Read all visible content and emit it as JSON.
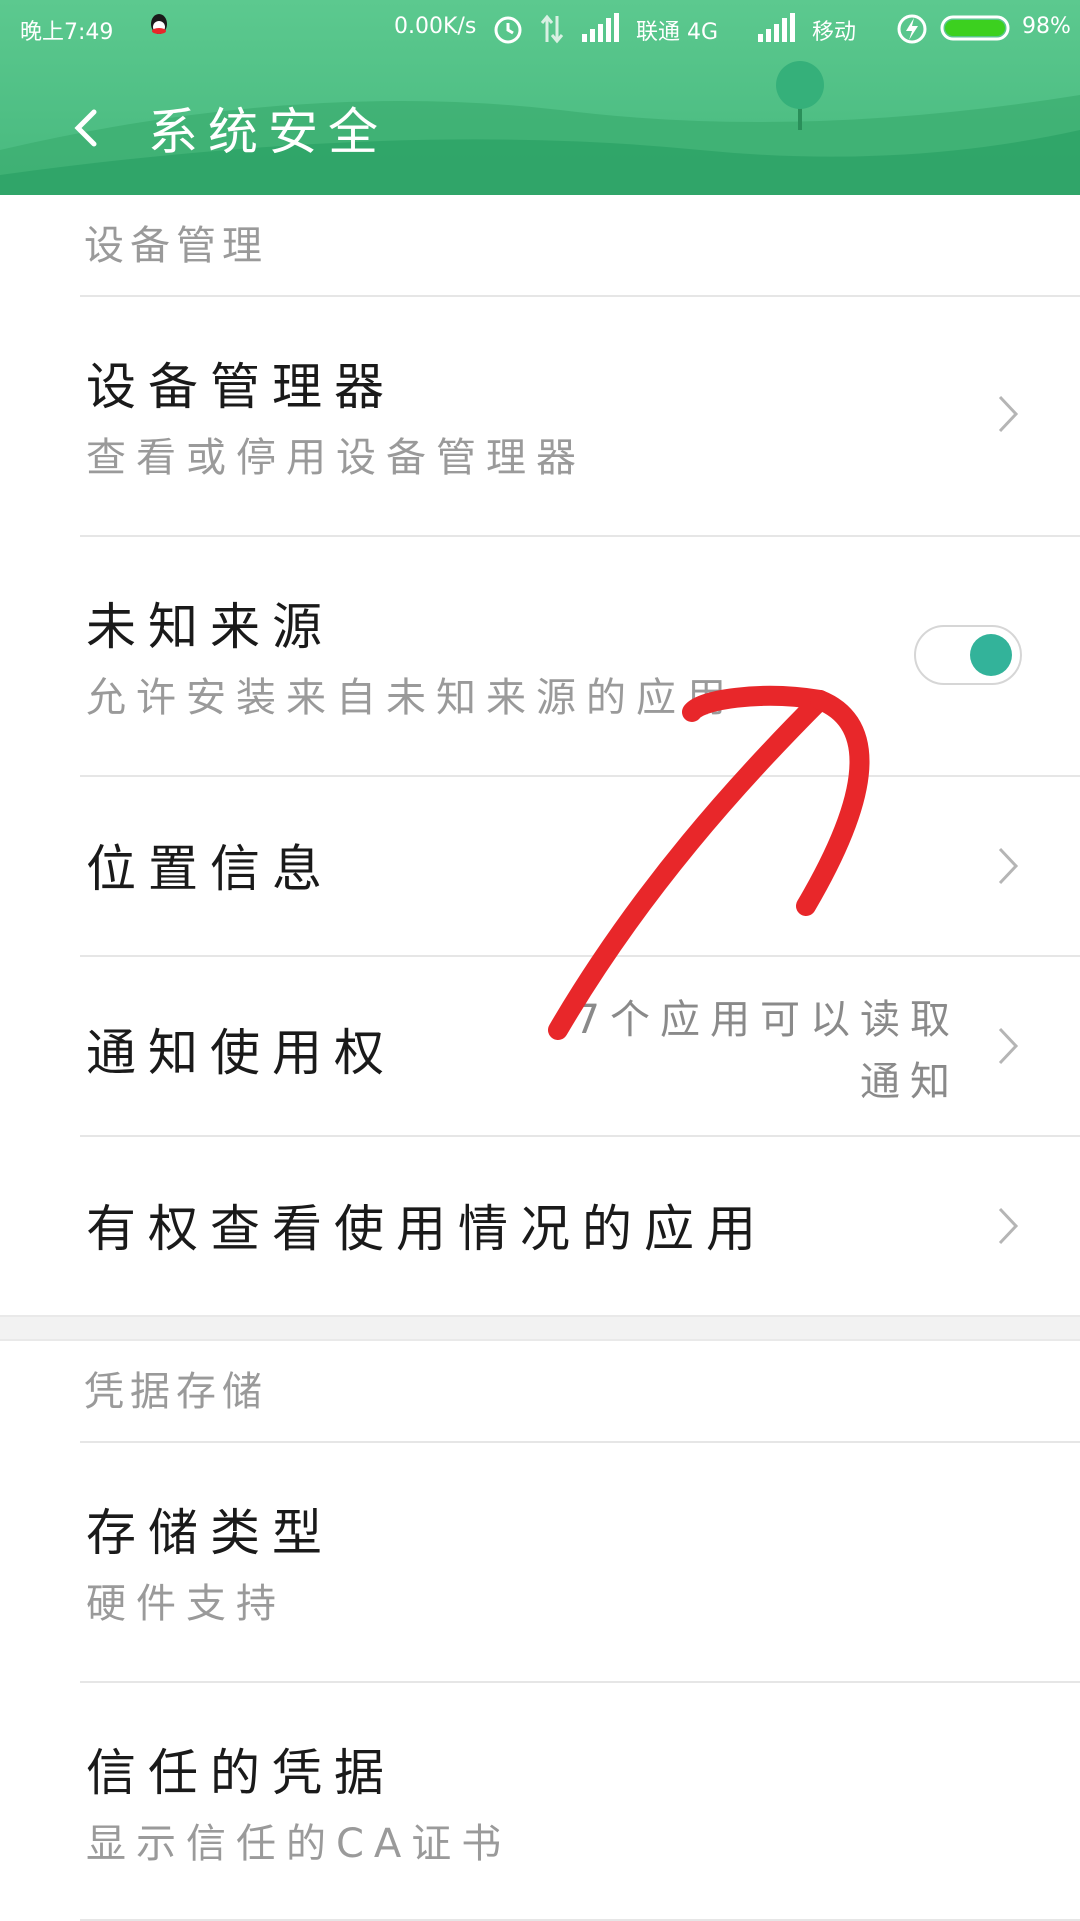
{
  "status_bar": {
    "time": "晚上7:49",
    "speed": "0.00K/s",
    "carrier1": "联通 4G",
    "carrier2": "移动",
    "battery": "98%",
    "battery_level": 0.98,
    "icons": [
      "qq-icon",
      "alarm-icon",
      "data-arrows-icon",
      "signal-icon",
      "charging-icon",
      "battery-icon"
    ]
  },
  "titlebar": {
    "back_icon": "back-arrow-icon",
    "title": "系统安全"
  },
  "sections": {
    "device_management": {
      "header": "设备管理",
      "device_admin": {
        "label": "设备管理器",
        "sub": "查看或停用设备管理器"
      },
      "unknown_sources": {
        "label": "未知来源",
        "sub": "允许安装来自未知来源的应用",
        "enabled": true
      },
      "location": {
        "label": "位置信息"
      },
      "notification_access": {
        "label": "通知使用权",
        "value": "7个应用可以读取通知"
      },
      "usage_access": {
        "label": "有权查看使用情况的应用"
      }
    },
    "credential_storage": {
      "header": "凭据存储",
      "storage_type": {
        "label": "存储类型",
        "sub": "硬件支持"
      },
      "trusted_credentials": {
        "label": "信任的凭据",
        "sub": "显示信任的CA证书"
      }
    }
  },
  "colors": {
    "header_green": "#4fbf85",
    "toggle_on": "#33b39a",
    "annotation_red": "#e8272a"
  }
}
